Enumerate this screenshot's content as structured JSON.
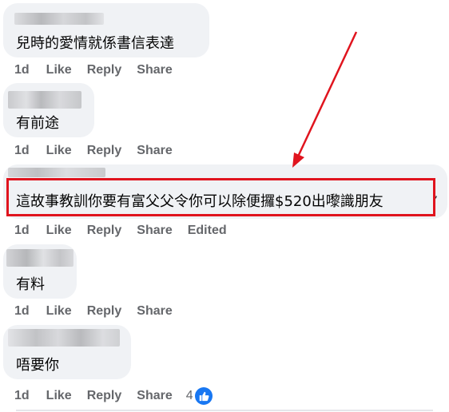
{
  "comments": [
    {
      "text": "兒時的愛情就係書信表達",
      "time": "1d",
      "like": "Like",
      "reply": "Reply",
      "share": "Share"
    },
    {
      "text": "有前途",
      "time": "1d",
      "like": "Like",
      "reply": "Reply",
      "share": "Share"
    },
    {
      "text": "這故事教訓你要有富父父令你可以除便攞$520出嚟識朋友",
      "time": "1d",
      "like": "Like",
      "reply": "Reply",
      "share": "Share",
      "edited": "Edited"
    },
    {
      "text": "有料",
      "time": "1d",
      "like": "Like",
      "reply": "Reply",
      "share": "Share"
    },
    {
      "text": "唔要你",
      "time": "1d",
      "like": "Like",
      "reply": "Reply",
      "share": "Share",
      "reaction_count": "4",
      "reaction_icon": "thumbs-up-icon"
    }
  ],
  "colors": {
    "bubble": "#f0f2f5",
    "action": "#65676b",
    "highlight": "#e0141e",
    "like_blue": "#1877f2"
  },
  "annotation": {
    "arrow_color": "#e0141e",
    "box_color": "#e0141e"
  }
}
